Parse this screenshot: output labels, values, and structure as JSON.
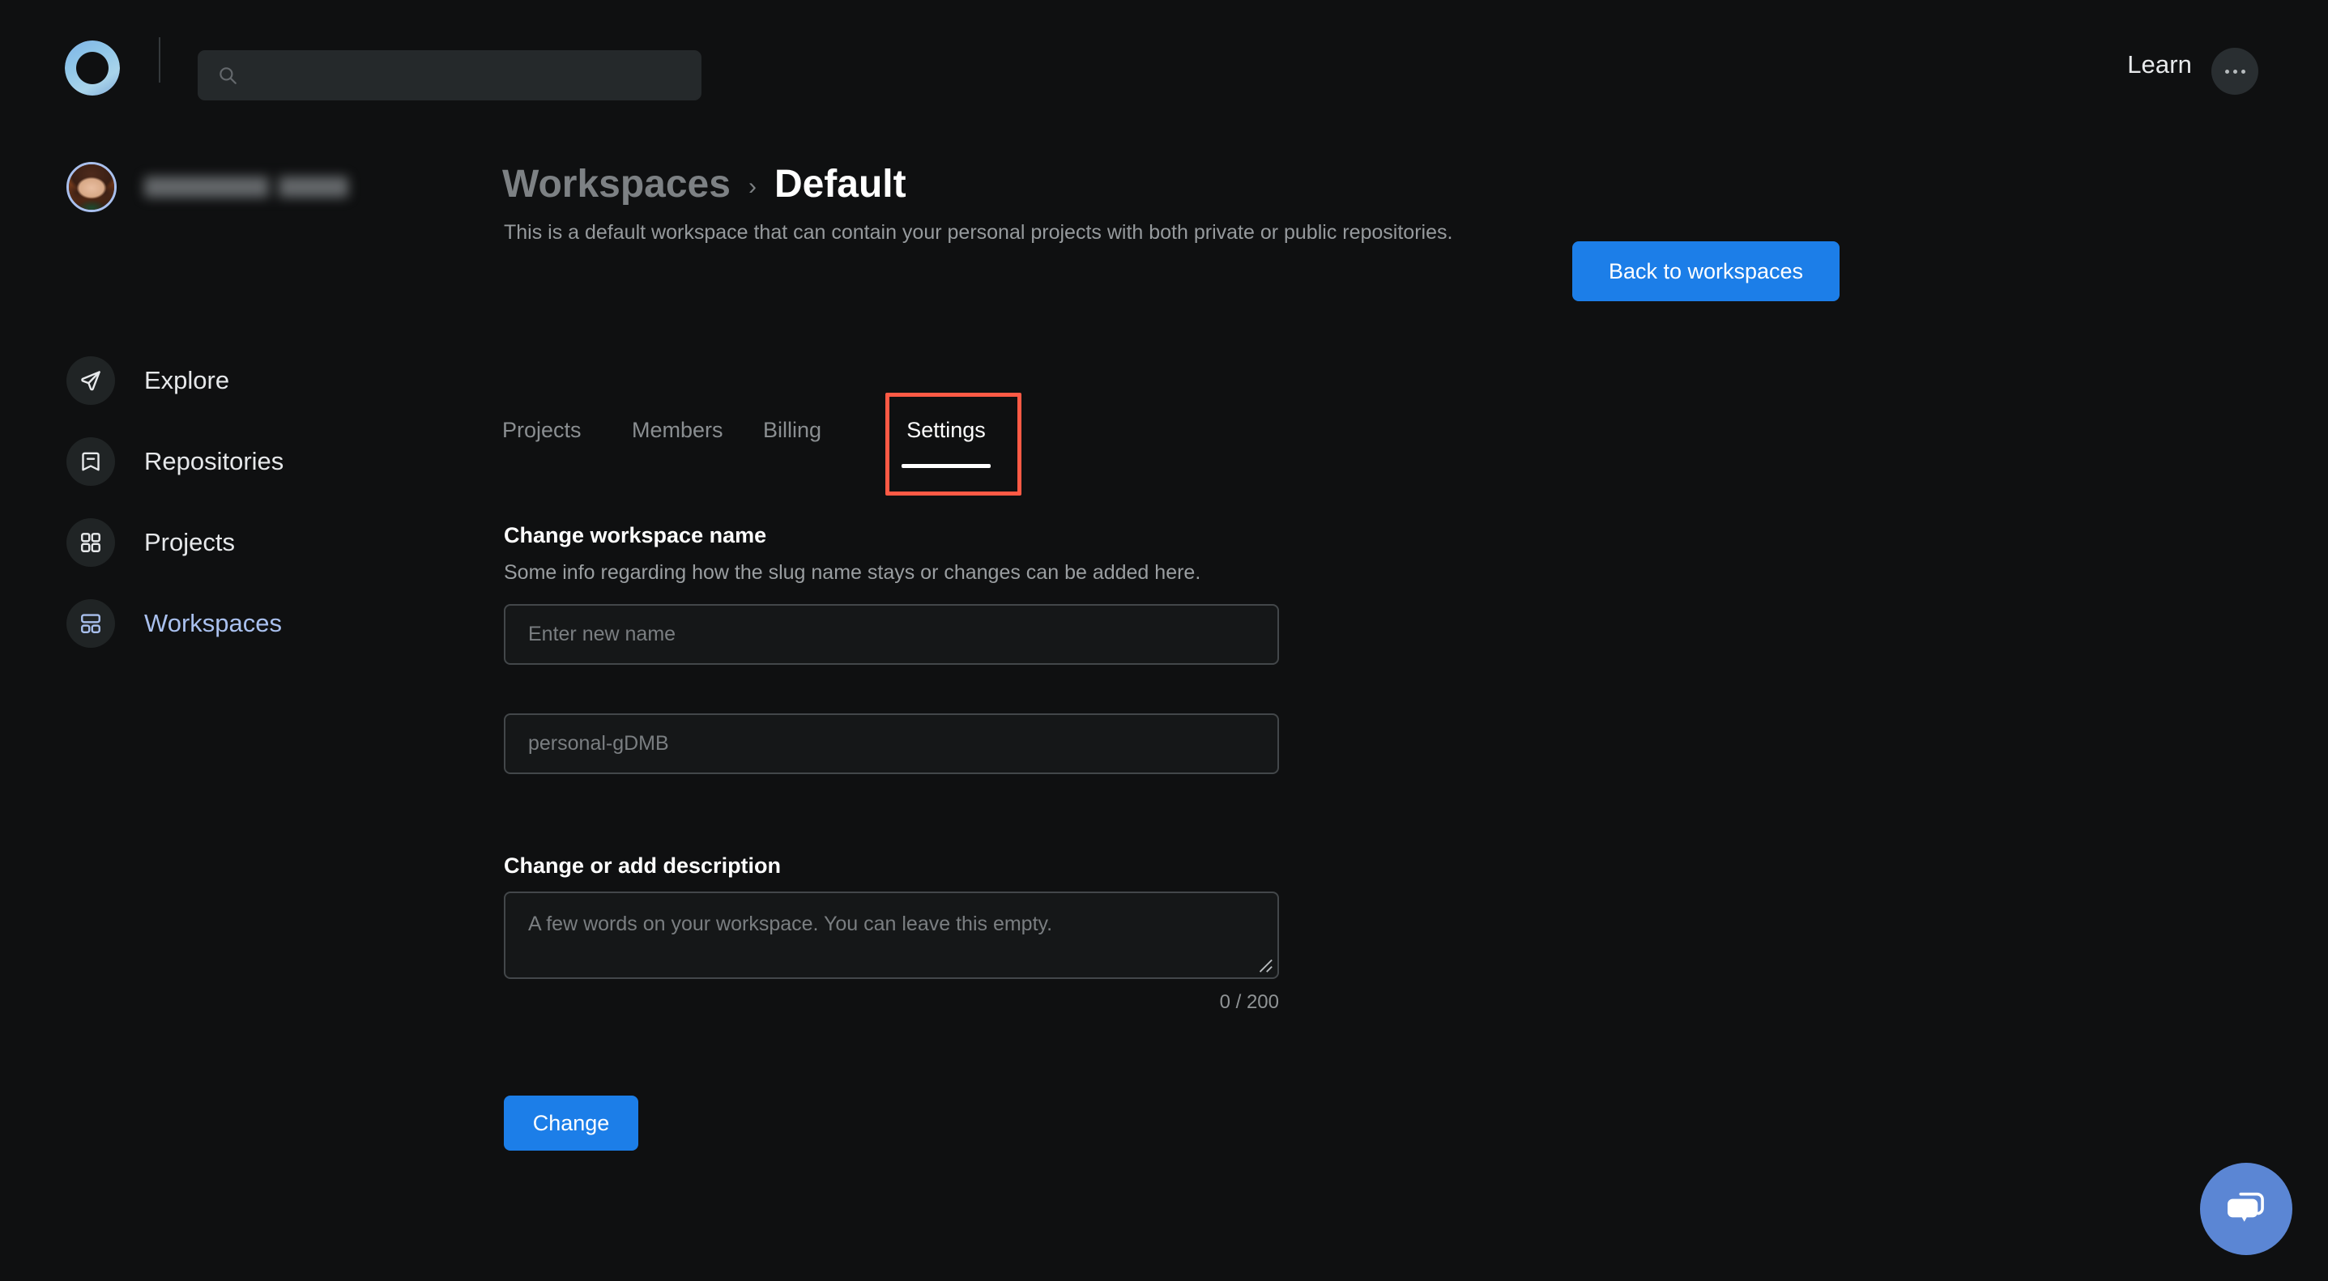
{
  "topbar": {
    "logo_icon": "ring-logo-icon",
    "search": {
      "value": "",
      "placeholder": ""
    },
    "search_icon": "search-icon",
    "learn_label": "Learn",
    "more_button_icon": "ellipsis-icon"
  },
  "sidebar": {
    "profile": {
      "avatar_icon": "avatar",
      "name": ""
    },
    "items": [
      {
        "label": "Explore",
        "icon": "send-icon",
        "active": false
      },
      {
        "label": "Repositories",
        "icon": "bookmark-minus-icon",
        "active": false
      },
      {
        "label": "Projects",
        "icon": "grid-squares-icon",
        "active": false
      },
      {
        "label": "Workspaces",
        "icon": "layout-panels-icon",
        "active": true
      }
    ]
  },
  "main": {
    "breadcrumb": {
      "root": "Workspaces",
      "separator": "›",
      "current": "Default"
    },
    "description": "This is a default workspace that can contain your personal projects with both private or public repositories.",
    "back_button_label": "Back to workspaces",
    "tabs": [
      {
        "label": "Projects",
        "active": false
      },
      {
        "label": "Members",
        "active": false
      },
      {
        "label": "Billing",
        "active": false
      },
      {
        "label": "Settings",
        "active": true
      }
    ],
    "name_section": {
      "title": "Change workspace name",
      "subtitle": "Some info regarding how the slug name stays or changes can be added here.",
      "name_input": {
        "value": "",
        "placeholder": "Enter new name"
      },
      "slug_input": {
        "value": "personal-gDMB",
        "placeholder": "personal-gDMB"
      }
    },
    "description_section": {
      "title": "Change or add description",
      "textarea": {
        "value": "",
        "placeholder": "A few words on your workspace. You can leave this empty."
      },
      "char_count": "0 / 200"
    },
    "submit_button_label": "Change"
  },
  "chat": {
    "icon": "chat-bubbles-icon"
  },
  "annotation": {
    "target": "Settings",
    "color": "#ff5a45"
  },
  "colors": {
    "page_background": "#0f1011",
    "accent_blue": "#1c7ee8",
    "active_nav": "#a9c0ee",
    "chat_fab": "#5b86d4",
    "annotation_red": "#ff5a45",
    "field_border": "#43474a",
    "muted_text": "#8a8e91"
  }
}
